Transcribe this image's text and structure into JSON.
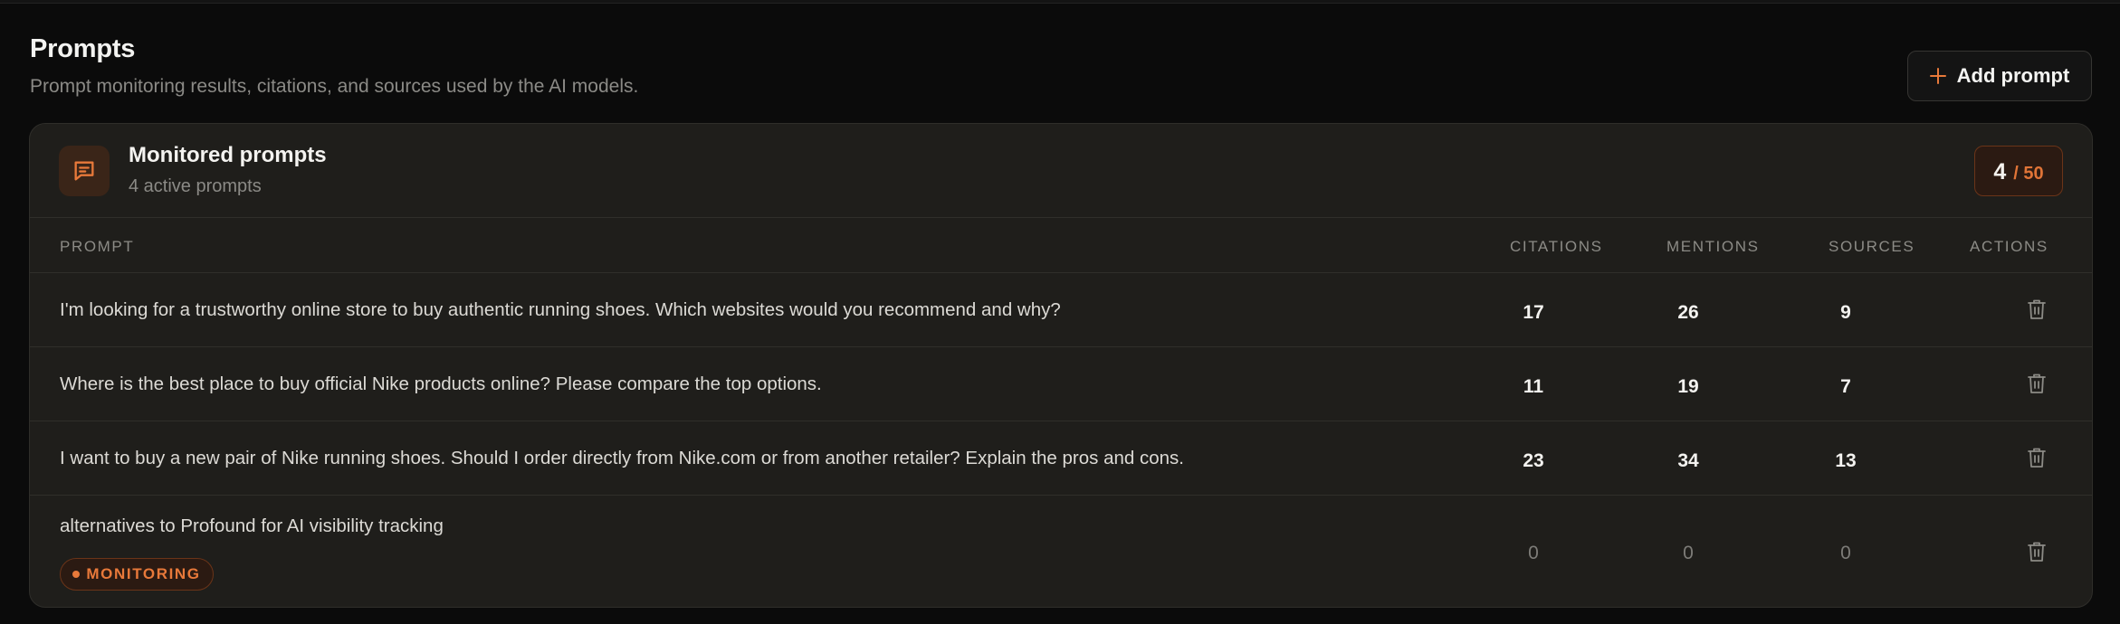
{
  "header": {
    "title": "Prompts",
    "subtitle": "Prompt monitoring results, citations, and sources used by the AI models.",
    "add_button_label": "Add prompt",
    "add_button_icon": "plus-icon"
  },
  "card": {
    "icon": "message-icon",
    "title": "Monitored prompts",
    "subtitle": "4 active prompts",
    "quota_used": "4",
    "quota_total": "/ 50"
  },
  "columns": {
    "prompt": "PROMPT",
    "citations": "CITATIONS",
    "mentions": "MENTIONS",
    "sources": "SOURCES",
    "actions": "ACTIONS"
  },
  "rows": [
    {
      "prompt": "I'm looking for a trustworthy online store to buy authentic running shoes. Which websites would you recommend and why?",
      "citations": "17",
      "mentions": "26",
      "sources": "9",
      "action_icon": "trash-icon"
    },
    {
      "prompt": "Where is the best place to buy official Nike products online? Please compare the top options.",
      "citations": "11",
      "mentions": "19",
      "sources": "7",
      "action_icon": "trash-icon"
    },
    {
      "prompt": "I want to buy a new pair of Nike running shoes. Should I order directly from Nike.com or from another retailer? Explain the pros and cons.",
      "citations": "23",
      "mentions": "34",
      "sources": "13",
      "action_icon": "trash-icon"
    },
    {
      "prompt": "alternatives to Profound for AI visibility tracking",
      "status": "MONITORING",
      "citations": "0",
      "mentions": "0",
      "sources": "0",
      "action_icon": "trash-icon"
    }
  ],
  "colors": {
    "accent": "#e8793a",
    "background": "#0b0b0b",
    "card": "#1f1e1b"
  }
}
